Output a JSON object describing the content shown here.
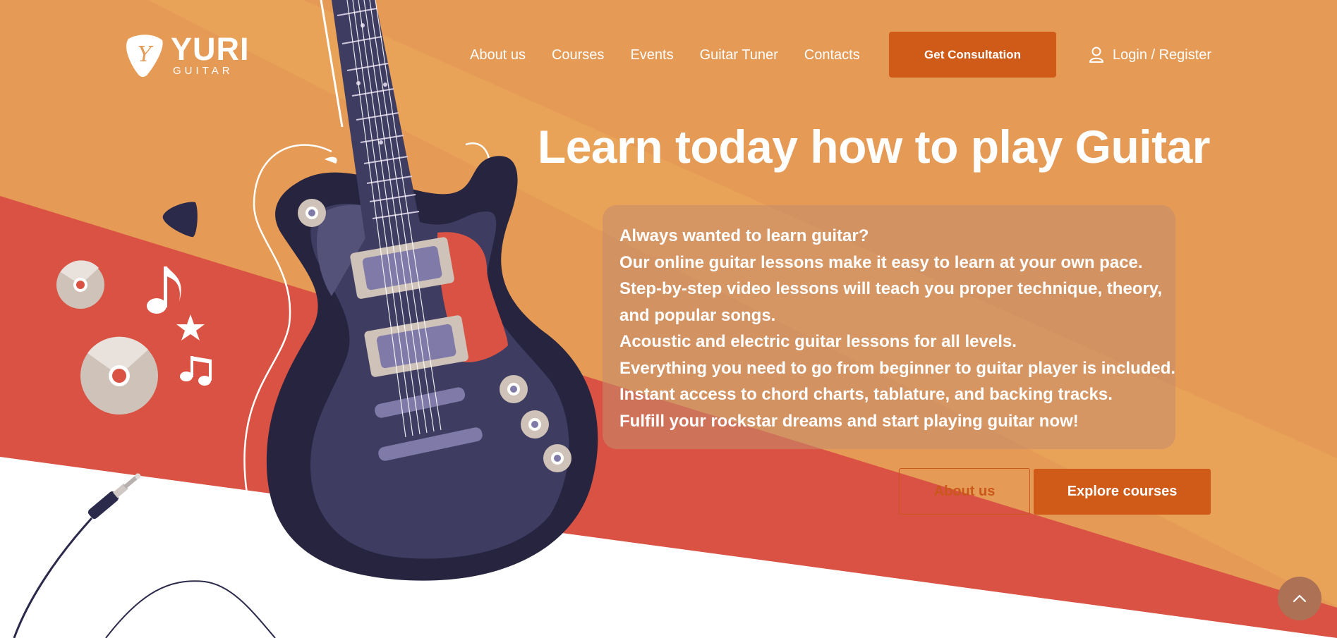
{
  "brand": {
    "name": "YURI",
    "sub": "GUITAR",
    "logo_glyph": "Y",
    "icon": "guitar-pick-logo-icon"
  },
  "nav": {
    "items": [
      {
        "label": "About us"
      },
      {
        "label": "Courses"
      },
      {
        "label": "Events"
      },
      {
        "label": "Guitar Tuner"
      },
      {
        "label": "Contacts"
      }
    ],
    "cta_label": "Get Consultation",
    "login_label": "Login / Register",
    "login_icon": "user-icon"
  },
  "hero": {
    "title": "Learn today how to play Guitar",
    "description": [
      "Always wanted to learn guitar?",
      "Our online guitar lessons make it easy to learn at your own pace.",
      "Step-by-step video lessons will teach you proper technique, theory,",
      "and popular songs.",
      "Acoustic and electric guitar lessons for all levels.",
      "Everything you need to go from beginner to guitar player is included.",
      "Instant access to chord charts, tablature, and backing tracks.",
      "Fulfill your rockstar dreams and start playing guitar now!"
    ],
    "about_button": "About us",
    "explore_button": "Explore courses"
  },
  "scroll_top_icon": "chevron-up-icon",
  "colors": {
    "background_orange": "#e59a55",
    "stripe_orange": "#e8a45a",
    "red_band": "#d95243",
    "accent": "#d05a18",
    "guitar_body": "#2b2a4a",
    "white": "#ffffff"
  }
}
